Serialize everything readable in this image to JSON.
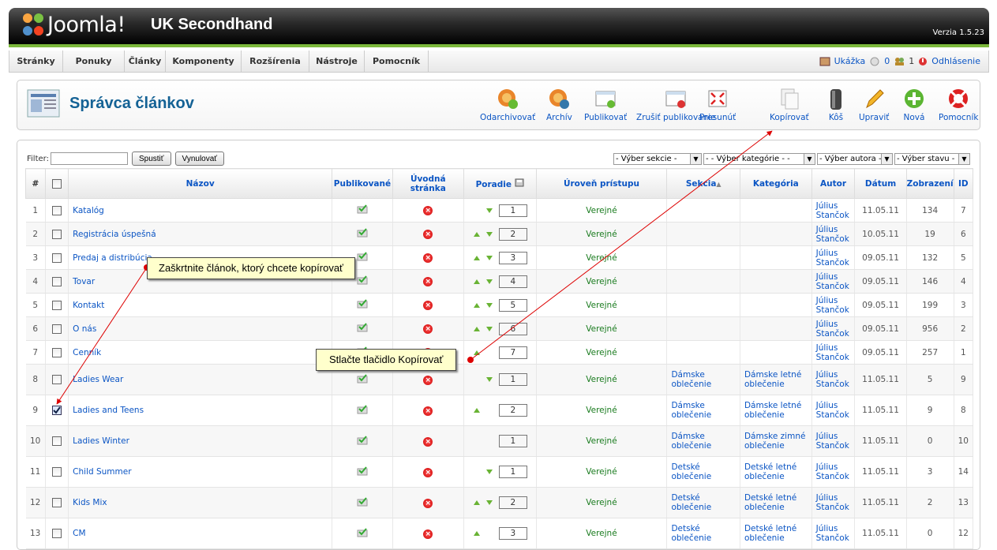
{
  "header": {
    "logo_text": "Joomla!",
    "site_name": "UK Secondhand",
    "version": "Verzia 1.5.23"
  },
  "menu": [
    "Stránky",
    "Ponuky",
    "Články",
    "Komponenty",
    "Rozšírenia",
    "Nástroje",
    "Pomocník"
  ],
  "status": {
    "preview": "Ukážka",
    "messages": "0",
    "users": "1",
    "logout": "Odhlásenie"
  },
  "page": {
    "title": "Správca článkov"
  },
  "toolbar": [
    {
      "label": "Odarchivovať",
      "icon": "unarchive-icon"
    },
    {
      "label": "Archív",
      "icon": "archive-icon"
    },
    {
      "label": "Publikovať",
      "icon": "publish-icon"
    },
    {
      "label": "Zrušiť publikovanie",
      "icon": "unpublish-icon"
    },
    {
      "label": "Presunúť",
      "icon": "move-icon"
    },
    {
      "label": "Kopírovať",
      "icon": "copy-icon"
    },
    {
      "label": "Kôš",
      "icon": "trash-icon"
    },
    {
      "label": "Upraviť",
      "icon": "edit-icon"
    },
    {
      "label": "Nová",
      "icon": "new-icon"
    },
    {
      "label": "Pomocník",
      "icon": "help-icon"
    }
  ],
  "filter": {
    "label": "Filter:",
    "value": "",
    "go": "Spustiť",
    "reset": "Vynulovať",
    "section": "- Výber sekcie -",
    "category": "- - Výber kategórie - -",
    "author": "- Výber autora -",
    "state": "- Výber stavu -"
  },
  "columns": {
    "num": "#",
    "title": "Názov",
    "published": "Publikované",
    "front": "Úvodná stránka",
    "order": "Poradie",
    "access": "Úroveň prístupu",
    "section": "Sekcia",
    "category": "Kategória",
    "author": "Autor",
    "date": "Dátum",
    "hits": "Zobrazení",
    "id": "ID"
  },
  "rows": [
    {
      "n": "1",
      "title": "Katalóg",
      "up": false,
      "down": true,
      "order": "1",
      "access": "Verejné",
      "section": "",
      "category": "",
      "author": "Július Stančok",
      "date": "11.05.11",
      "hits": "134",
      "id": "7",
      "checked": false
    },
    {
      "n": "2",
      "title": "Registrácia úspešná",
      "up": true,
      "down": true,
      "order": "2",
      "access": "Verejné",
      "section": "",
      "category": "",
      "author": "Július Stančok",
      "date": "10.05.11",
      "hits": "19",
      "id": "6",
      "checked": false
    },
    {
      "n": "3",
      "title": "Predaj a distribúcia",
      "up": true,
      "down": true,
      "order": "3",
      "access": "Verejné",
      "section": "",
      "category": "",
      "author": "Július Stančok",
      "date": "09.05.11",
      "hits": "132",
      "id": "5",
      "checked": false
    },
    {
      "n": "4",
      "title": "Tovar",
      "up": true,
      "down": true,
      "order": "4",
      "access": "Verejné",
      "section": "",
      "category": "",
      "author": "Július Stančok",
      "date": "09.05.11",
      "hits": "146",
      "id": "4",
      "checked": false
    },
    {
      "n": "5",
      "title": "Kontakt",
      "up": true,
      "down": true,
      "order": "5",
      "access": "Verejné",
      "section": "",
      "category": "",
      "author": "Július Stančok",
      "date": "09.05.11",
      "hits": "199",
      "id": "3",
      "checked": false
    },
    {
      "n": "6",
      "title": "O nás",
      "up": true,
      "down": true,
      "order": "6",
      "access": "Verejné",
      "section": "",
      "category": "",
      "author": "Július Stančok",
      "date": "09.05.11",
      "hits": "956",
      "id": "2",
      "checked": false
    },
    {
      "n": "7",
      "title": "Cenník",
      "up": true,
      "down": false,
      "order": "7",
      "access": "Verejné",
      "section": "",
      "category": "",
      "author": "Július Stančok",
      "date": "09.05.11",
      "hits": "257",
      "id": "1",
      "checked": false
    },
    {
      "n": "8",
      "title": "Ladies Wear",
      "up": false,
      "down": true,
      "order": "1",
      "access": "Verejné",
      "section": "Dámske oblečenie",
      "category": "Dámske letné oblečenie",
      "author": "Július Stančok",
      "date": "11.05.11",
      "hits": "5",
      "id": "9",
      "checked": false
    },
    {
      "n": "9",
      "title": "Ladies and Teens",
      "up": true,
      "down": false,
      "order": "2",
      "access": "Verejné",
      "section": "Dámske oblečenie",
      "category": "Dámske letné oblečenie",
      "author": "Július Stančok",
      "date": "11.05.11",
      "hits": "9",
      "id": "8",
      "checked": true
    },
    {
      "n": "10",
      "title": "Ladies Winter",
      "up": false,
      "down": false,
      "order": "1",
      "access": "Verejné",
      "section": "Dámske oblečenie",
      "category": "Dámske zimné oblečenie",
      "author": "Július Stančok",
      "date": "11.05.11",
      "hits": "0",
      "id": "10",
      "checked": false
    },
    {
      "n": "11",
      "title": "Child Summer",
      "up": false,
      "down": true,
      "order": "1",
      "access": "Verejné",
      "section": "Detské oblečenie",
      "category": "Detské letné oblečenie",
      "author": "Július Stančok",
      "date": "11.05.11",
      "hits": "3",
      "id": "14",
      "checked": false
    },
    {
      "n": "12",
      "title": "Kids Mix",
      "up": true,
      "down": true,
      "order": "2",
      "access": "Verejné",
      "section": "Detské oblečenie",
      "category": "Detské letné oblečenie",
      "author": "Július Stančok",
      "date": "11.05.11",
      "hits": "2",
      "id": "13",
      "checked": false
    },
    {
      "n": "13",
      "title": "CM",
      "up": true,
      "down": false,
      "order": "3",
      "access": "Verejné",
      "section": "Detské oblečenie",
      "category": "Detské letné oblečenie",
      "author": "Július Stančok",
      "date": "11.05.11",
      "hits": "0",
      "id": "12",
      "checked": false
    }
  ],
  "callouts": {
    "check": "Zaškrtnite článok, ktorý chcete kopírovať",
    "press": "Stlačte tlačidlo Kopírovať"
  }
}
